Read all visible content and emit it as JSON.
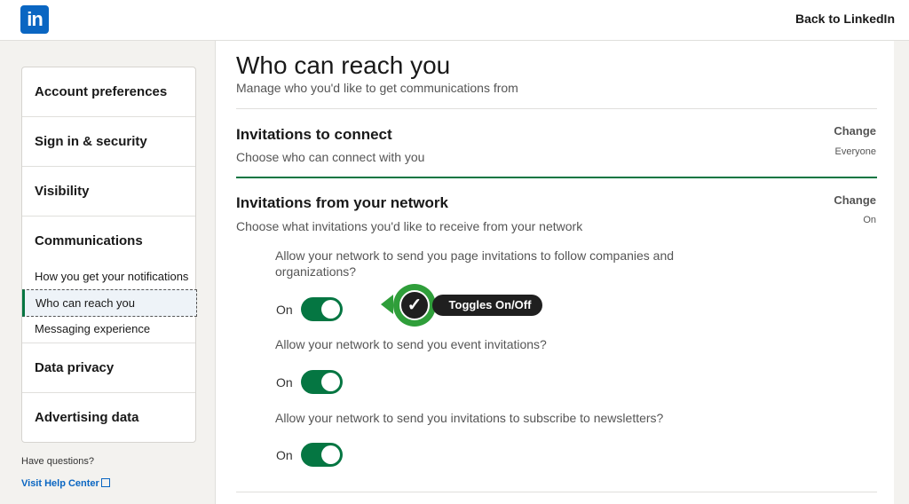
{
  "header": {
    "logo_text": "in",
    "back_link": "Back to LinkedIn"
  },
  "sidebar": {
    "sections": [
      {
        "label": "Account preferences"
      },
      {
        "label": "Sign in & security"
      },
      {
        "label": "Visibility"
      },
      {
        "label": "Communications"
      },
      {
        "label": "Data privacy"
      },
      {
        "label": "Advertising data"
      }
    ],
    "sub_items": [
      {
        "label": "How you get your notifications"
      },
      {
        "label": "Who can reach you",
        "active": true
      },
      {
        "label": "Messaging experience"
      }
    ],
    "questions": "Have questions?",
    "help_link": "Visit Help Center"
  },
  "main": {
    "title": "Who can reach you",
    "subtitle": "Manage who you'd like to get communications from",
    "invitations_connect": {
      "title": "Invitations to connect",
      "subtitle": "Choose who can connect with you",
      "change": "Change",
      "value": "Everyone"
    },
    "invitations_network": {
      "title": "Invitations from your network",
      "subtitle": "Choose what invitations you'd like to receive from your network",
      "change": "Change",
      "value": "On",
      "settings": [
        {
          "question": "Allow your network to send you page invitations to follow companies and organizations?",
          "state": "On"
        },
        {
          "question": "Allow your network to send you event invitations?",
          "state": "On"
        },
        {
          "question": "Allow your network to send you invitations to subscribe to newsletters?",
          "state": "On"
        }
      ]
    }
  },
  "annotation": {
    "label": "Toggles On/Off",
    "icon": "check-icon"
  },
  "colors": {
    "brand": "#0a66c2",
    "toggle_on": "#057642",
    "callout_green": "#2f9e3a"
  }
}
